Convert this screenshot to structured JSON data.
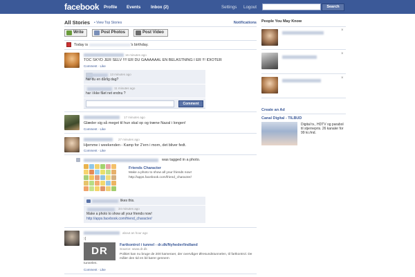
{
  "topbar": {
    "logo": "facebook",
    "nav": [
      "Profile",
      "Events",
      "Inbox (2)"
    ],
    "settings": "Settings",
    "logout": "Logout",
    "search_placeholder": "",
    "search_button": "Search"
  },
  "feed": {
    "title": "All Stories",
    "view_top": "• View Top Stories",
    "notifications": "Notifications",
    "publisher": {
      "write": "Write",
      "photos": "Post Photos",
      "video": "Post Video"
    },
    "birthday_prefix": "Today is",
    "birthday_suffix": "'s birthday."
  },
  "stories": [
    {
      "time": "16 minutes ago",
      "text": "TOC SKYD JER SELV !!!! ER DU GAAAAAAL EN BELASTNING I ER !!! IDIOTER",
      "actions": "Comment · Like",
      "comments": [
        {
          "time": "13 minutes ago",
          "text": "har du en dårlig dag?"
        },
        {
          "time": "11 minutes ago",
          "text": "har i ikke fået net endnu ?"
        }
      ],
      "comment_button": "Comment"
    },
    {
      "time": "17 minutes ago",
      "text": "Glæder sig så meget til hun skal op og træne Nazal i longen!",
      "actions": "Comment · Like"
    },
    {
      "time": "27 minutes ago",
      "text": "Hjemme i weekenden - Kamp for 2'ern i morn, det bliver fedt.",
      "actions": "Comment · Like"
    },
    {
      "tag_text": "was tagged in a photo.",
      "attach_title": "Friends Character",
      "attach_desc": "Make a photo to show all your friends now!",
      "attach_url": "http://apps.facebook.com/friend_character/",
      "likes_text": "likes this.",
      "inner_time": "34 minutes ago",
      "inner_text": "Make a photo to show all your friends now!",
      "inner_url": "http://apps.facebook.com/friend_character/"
    },
    {
      "time": "about an hour ago",
      "text": ":(",
      "logo": "DR",
      "attach_title": "Fartkontrol i tunnel - dr.dk/Nyheder/Indland",
      "attach_source": "Source: www.dr.dk",
      "attach_desc": "Politiet kan nu bruge de 200 kameraer, der overvåger Øresundstunnelen, til fartkontrol. De måler den tid en bil kører gennem",
      "attach_desc2": "tunnelen.",
      "actions": "Comment · Like"
    }
  ],
  "sidebar": {
    "people_title": "People You May Know",
    "close": "×",
    "create_ad": "Create an Ad",
    "ad_title": "Canal Digital - TILBUD",
    "ad_text": "Digital tv., HDTV og parabol til stjernepris. 26 kanaler for 99 kr./md."
  },
  "colors": {
    "brand": "#3b5998",
    "topbar": "#3b5998",
    "link": "#3b5998",
    "comment_bg": "#eceff5"
  }
}
